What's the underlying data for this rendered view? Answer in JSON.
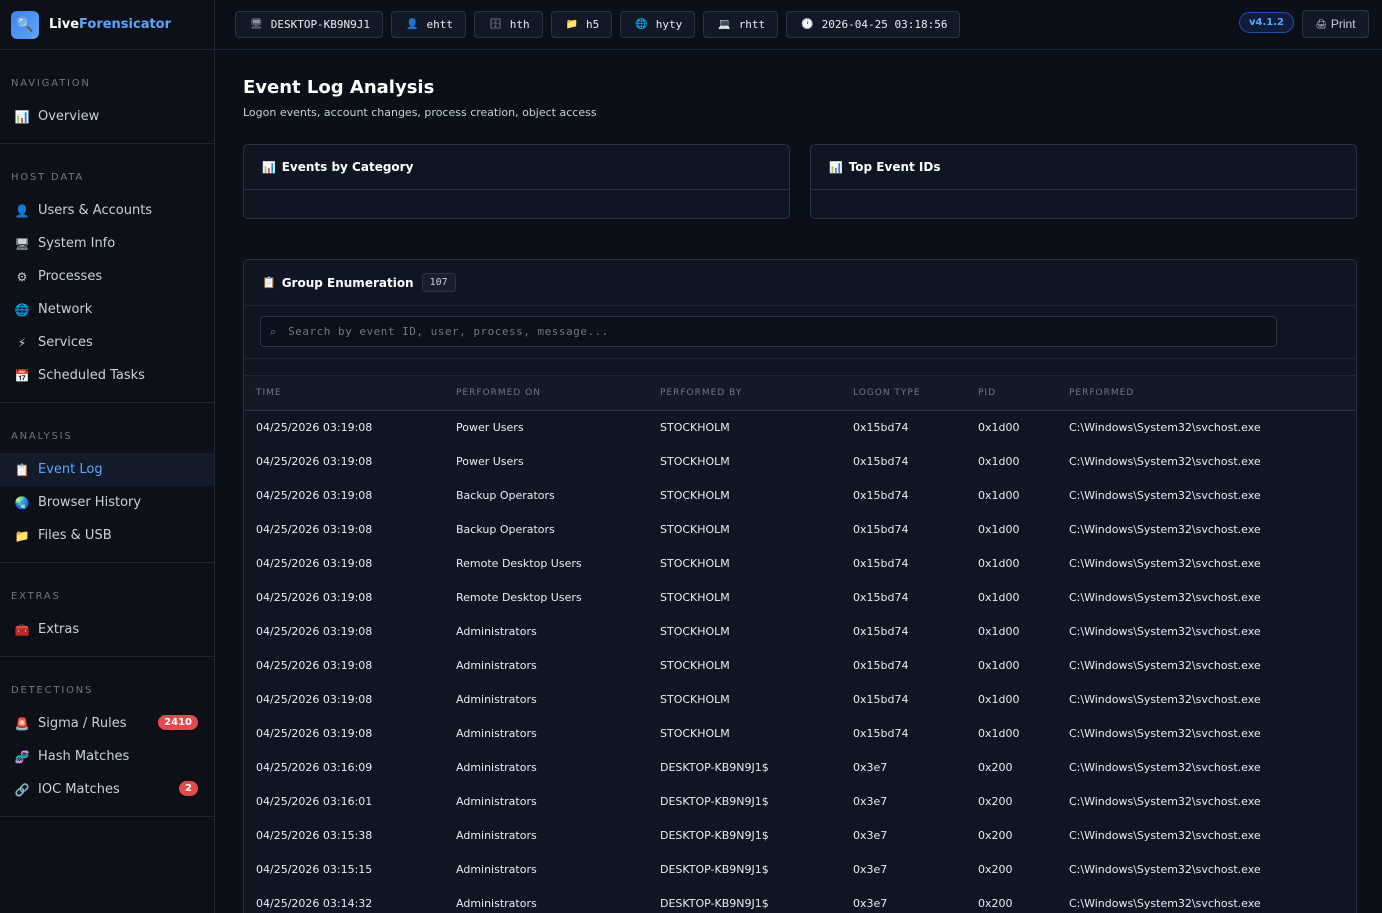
{
  "brand": {
    "part1": "Live",
    "part2": "Forensicator",
    "logo_icon": "🔍"
  },
  "sidebar": {
    "sections": [
      {
        "title": "NAVIGATION",
        "items": [
          {
            "label": "Overview",
            "icon": "📊"
          }
        ]
      },
      {
        "title": "HOST DATA",
        "items": [
          {
            "label": "Users & Accounts",
            "icon": "👤"
          },
          {
            "label": "System Info",
            "icon": "🖥"
          },
          {
            "label": "Processes",
            "icon": "⚙"
          },
          {
            "label": "Network",
            "icon": "🌐"
          },
          {
            "label": "Services",
            "icon": "⚡"
          },
          {
            "label": "Scheduled Tasks",
            "icon": "📅"
          }
        ]
      },
      {
        "title": "ANALYSIS",
        "items": [
          {
            "label": "Event Log",
            "icon": "📋",
            "active": true
          },
          {
            "label": "Browser History",
            "icon": "🌏"
          },
          {
            "label": "Files & USB",
            "icon": "📁"
          }
        ]
      },
      {
        "title": "EXTRAS",
        "items": [
          {
            "label": "Extras",
            "icon": "🧰"
          }
        ]
      },
      {
        "title": "DETECTIONS",
        "items": [
          {
            "label": "Sigma / Rules",
            "icon": "🚨",
            "badge": "2410"
          },
          {
            "label": "Hash Matches",
            "icon": "🧬"
          },
          {
            "label": "IOC Matches",
            "icon": "🔗",
            "badge": "2"
          }
        ]
      }
    ]
  },
  "topbar": {
    "chips": [
      {
        "icon": "🖥",
        "label": "DESKTOP-KB9N9J1"
      },
      {
        "icon": "👤",
        "label": "ehtt"
      },
      {
        "icon": "🗄",
        "label": "hth"
      },
      {
        "icon": "📁",
        "label": "h5"
      },
      {
        "icon": "🌐",
        "label": "hyty"
      },
      {
        "icon": "💻",
        "label": "rhtt"
      },
      {
        "icon": "🕐",
        "label": "2026-04-25 03:18:56"
      }
    ],
    "version": "v4.1.2",
    "print_label": "Print",
    "print_icon": "🖨"
  },
  "main": {
    "title": "Event Log Analysis",
    "subtitle": "Logon events, account changes, process creation, object access",
    "cards": [
      {
        "icon": "📊",
        "title": "Events by Category"
      },
      {
        "icon": "📊",
        "title": "Top Event IDs"
      }
    ],
    "panel": {
      "icon": "📋",
      "title": "Group Enumeration",
      "count": "107",
      "search_placeholder": "Search by event ID, user, process, message...",
      "columns": [
        "TIME",
        "PERFORMED ON",
        "PERFORMED BY",
        "LOGON TYPE",
        "PID",
        "PERFORMED"
      ],
      "rows": [
        [
          "04/25/2026 03:19:08",
          "Power Users",
          "STOCKHOLM",
          "0x15bd74",
          "0x1d00",
          "C:\\Windows\\System32\\svchost.exe"
        ],
        [
          "04/25/2026 03:19:08",
          "Power Users",
          "STOCKHOLM",
          "0x15bd74",
          "0x1d00",
          "C:\\Windows\\System32\\svchost.exe"
        ],
        [
          "04/25/2026 03:19:08",
          "Backup Operators",
          "STOCKHOLM",
          "0x15bd74",
          "0x1d00",
          "C:\\Windows\\System32\\svchost.exe"
        ],
        [
          "04/25/2026 03:19:08",
          "Backup Operators",
          "STOCKHOLM",
          "0x15bd74",
          "0x1d00",
          "C:\\Windows\\System32\\svchost.exe"
        ],
        [
          "04/25/2026 03:19:08",
          "Remote Desktop Users",
          "STOCKHOLM",
          "0x15bd74",
          "0x1d00",
          "C:\\Windows\\System32\\svchost.exe"
        ],
        [
          "04/25/2026 03:19:08",
          "Remote Desktop Users",
          "STOCKHOLM",
          "0x15bd74",
          "0x1d00",
          "C:\\Windows\\System32\\svchost.exe"
        ],
        [
          "04/25/2026 03:19:08",
          "Administrators",
          "STOCKHOLM",
          "0x15bd74",
          "0x1d00",
          "C:\\Windows\\System32\\svchost.exe"
        ],
        [
          "04/25/2026 03:19:08",
          "Administrators",
          "STOCKHOLM",
          "0x15bd74",
          "0x1d00",
          "C:\\Windows\\System32\\svchost.exe"
        ],
        [
          "04/25/2026 03:19:08",
          "Administrators",
          "STOCKHOLM",
          "0x15bd74",
          "0x1d00",
          "C:\\Windows\\System32\\svchost.exe"
        ],
        [
          "04/25/2026 03:19:08",
          "Administrators",
          "STOCKHOLM",
          "0x15bd74",
          "0x1d00",
          "C:\\Windows\\System32\\svchost.exe"
        ],
        [
          "04/25/2026 03:16:09",
          "Administrators",
          "DESKTOP-KB9N9J1$",
          "0x3e7",
          "0x200",
          "C:\\Windows\\System32\\svchost.exe"
        ],
        [
          "04/25/2026 03:16:01",
          "Administrators",
          "DESKTOP-KB9N9J1$",
          "0x3e7",
          "0x200",
          "C:\\Windows\\System32\\svchost.exe"
        ],
        [
          "04/25/2026 03:15:38",
          "Administrators",
          "DESKTOP-KB9N9J1$",
          "0x3e7",
          "0x200",
          "C:\\Windows\\System32\\svchost.exe"
        ],
        [
          "04/25/2026 03:15:15",
          "Administrators",
          "DESKTOP-KB9N9J1$",
          "0x3e7",
          "0x200",
          "C:\\Windows\\System32\\svchost.exe"
        ],
        [
          "04/25/2026 03:14:32",
          "Administrators",
          "DESKTOP-KB9N9J1$",
          "0x3e7",
          "0x200",
          "C:\\Windows\\System32\\svchost.exe"
        ]
      ]
    }
  },
  "colors": {
    "accent": "#58a6ff",
    "badge": "#e5484d",
    "background": "#0b0f17"
  }
}
